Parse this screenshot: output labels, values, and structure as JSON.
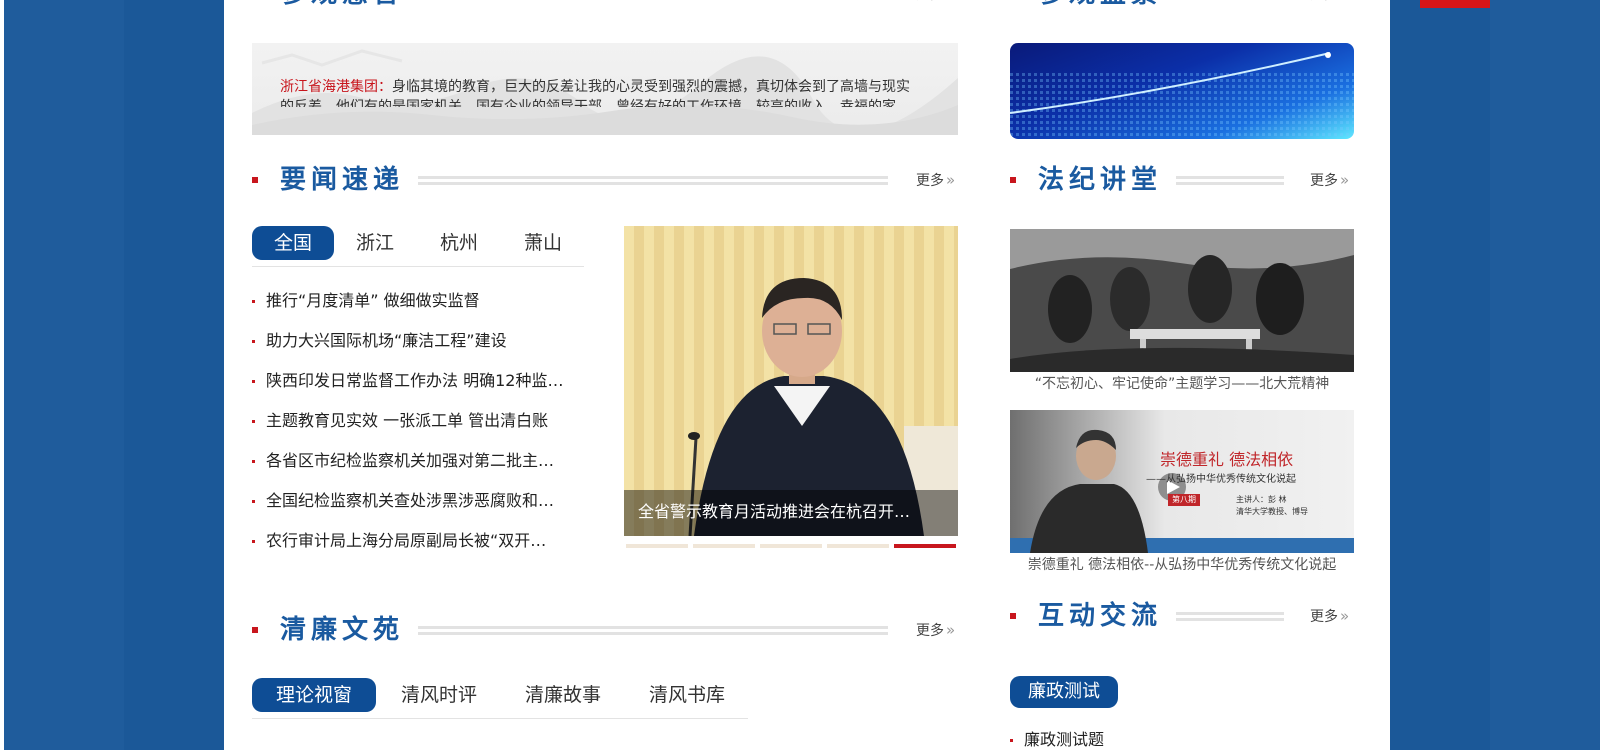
{
  "top_sections": {
    "left_title": "参观感言",
    "right_title": "参观盛景",
    "more_label": "更多"
  },
  "testimonial": {
    "source": "浙江省海港集团：",
    "text_line1": "身临其境的教育，巨大的反差让我的心灵受到强烈的震撼，真切体会到了高墙与现实",
    "text_line2": "的反差，他们有的是国家机关、国有企业的领导干部，曾经有好的工作环境，较高的收入，幸福的家…"
  },
  "top_right_button": "",
  "news_section": {
    "title": "要闻速递",
    "more_label": "更多",
    "tabs": [
      "全国",
      "浙江",
      "杭州",
      "萧山"
    ],
    "items": [
      "推行“月度清单” 做细做实监督",
      "助力大兴国际机场“廉洁工程”建设",
      "陕西印发日常监督工作办法 明确12种监…",
      "主题教育见实效 一张派工单 管出清白账",
      "各省区市纪检监察机关加强对第二批主…",
      "全国纪检监察机关查处涉黑涉恶腐败和…",
      "农行审计局上海分局原副局长被“双开…"
    ],
    "slide_caption": "全省警示教育月活动推进会在杭召开…"
  },
  "law_section": {
    "title": "法纪讲堂",
    "more_label": "更多",
    "video1_caption": "“不忘初心、牢记使命”主题学习——北大荒精神",
    "video2_caption": "崇德重礼 德法相依--从弘扬中华优秀传统文化说起",
    "video2_overlay_title": "崇德重礼 德法相依",
    "video2_overlay_sub": "——从弘扬中华优秀传统文化说起",
    "video2_episode": "第八期",
    "video2_lecturer": "主讲人：彭 林",
    "video2_lecturer_title": "清华大学教授、博导"
  },
  "literature_section": {
    "title": "清廉文苑",
    "more_label": "更多",
    "tabs": [
      "理论视窗",
      "清风时评",
      "清廉故事",
      "清风书库"
    ]
  },
  "interaction_section": {
    "title": "互动交流",
    "more_label": "更多",
    "tab": "廉政测试",
    "items": [
      "廉政测试题"
    ]
  },
  "colors": {
    "page_bg": "#1f5c9c",
    "brand_blue": "#0e4d95",
    "accent_red": "#c8161d"
  }
}
